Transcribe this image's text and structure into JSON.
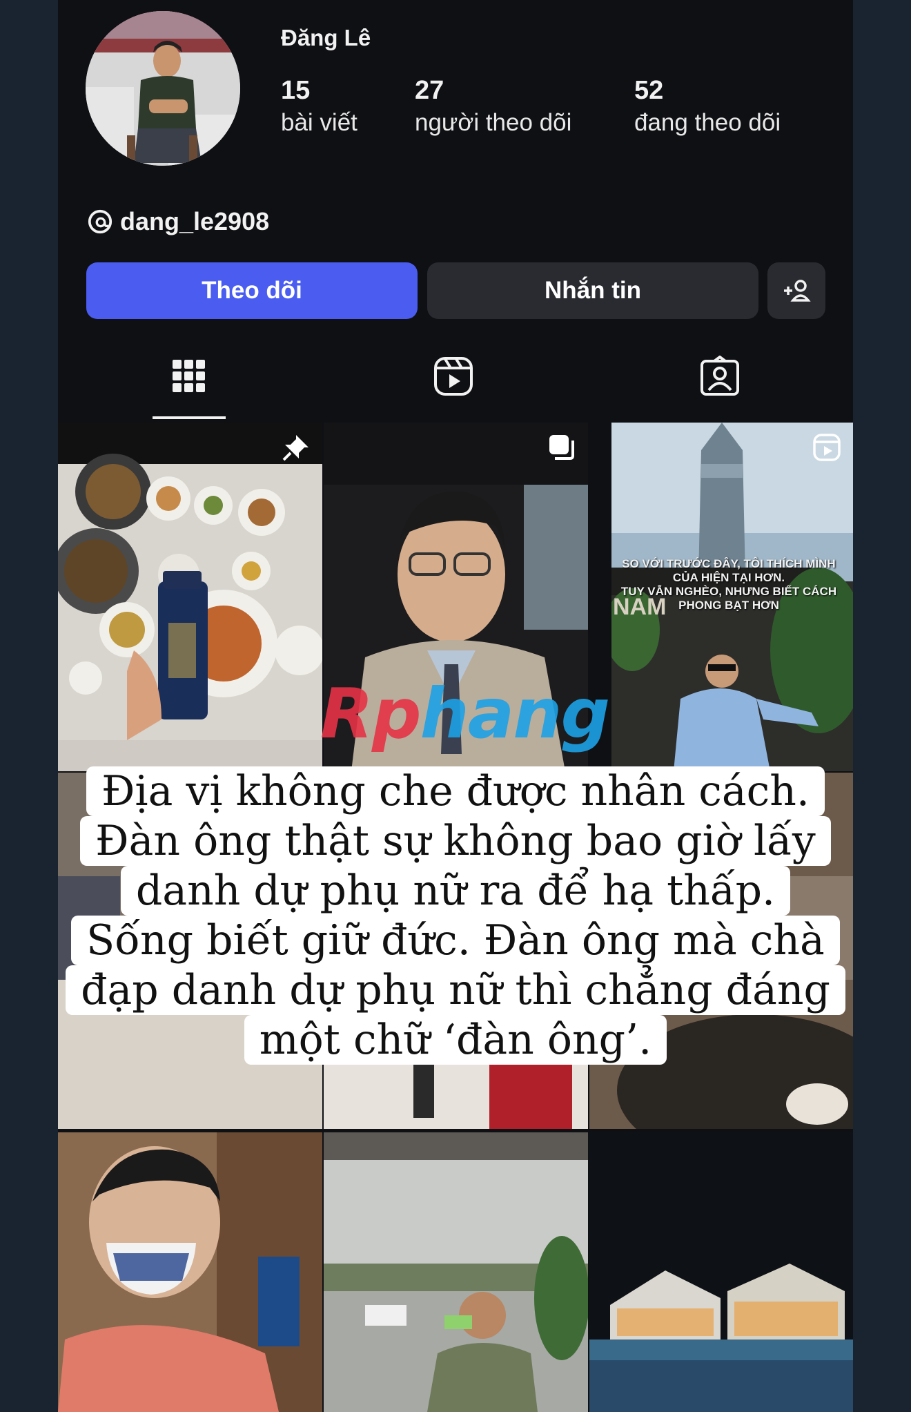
{
  "profile": {
    "name": "Đăng Lê",
    "stats": [
      {
        "value": "15",
        "label": "bài viết"
      },
      {
        "value": "27",
        "label": "người theo dõi"
      },
      {
        "value": "52",
        "label": "đang theo dõi"
      }
    ],
    "threads_handle": "dang_le2908"
  },
  "actions": {
    "follow_label": "Theo dõi",
    "message_label": "Nhắn tin",
    "add_icon": "person-add-icon"
  },
  "tabs": [
    {
      "icon": "grid-icon",
      "active": true
    },
    {
      "icon": "reels-icon",
      "active": false
    },
    {
      "icon": "tagged-icon",
      "active": false
    }
  ],
  "posts": {
    "reel_caption": [
      "SO VỚI TRƯỚC ĐÂY, TÔI THÍCH MÌNH",
      "CỦA HIỆN TẠI HƠN.",
      "TUY VẪN NGHÈO, NHƯNG BIẾT CÁCH",
      "PHONG BẠT HƠN"
    ],
    "sign_text": "NAM"
  },
  "overlay": {
    "lines": [
      "Địa vị không che được nhân cách.",
      "Đàn ông thật sự không bao giờ lấy",
      "danh dự phụ nữ ra để hạ thấp.",
      "Sống biết giữ đức. Đàn ông mà chà",
      "đạp danh dự phụ nữ thì chẳng đáng",
      "một chữ ‘đàn ông’."
    ]
  },
  "watermark": {
    "part1": "Rp",
    "part2": "hang"
  },
  "colors": {
    "accent": "#4a5df0",
    "bg": "#0f1014",
    "button": "#2a2b30"
  }
}
